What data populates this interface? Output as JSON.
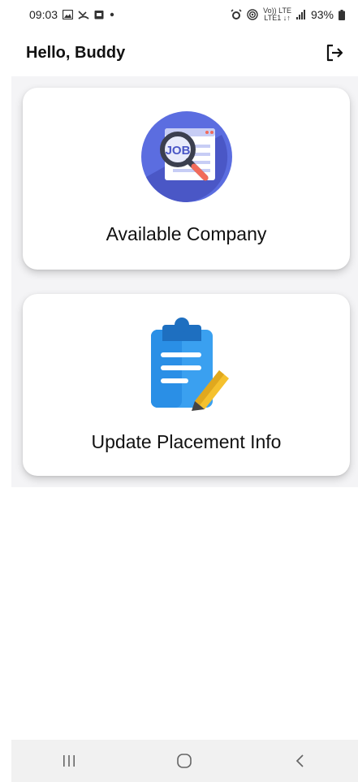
{
  "status_bar": {
    "time": "09:03",
    "battery": "93%",
    "volte_line1": "Vo)) LTE",
    "volte_line2": "LTE1 ↓↑"
  },
  "app_bar": {
    "greeting": "Hello, Buddy"
  },
  "cards": [
    {
      "label": "Available Company",
      "icon": "job-search-icon",
      "icon_text": "JOB"
    },
    {
      "label": "Update Placement Info",
      "icon": "clipboard-edit-icon"
    }
  ],
  "nav_bar": {
    "items": [
      "recent-apps",
      "home",
      "back"
    ]
  },
  "colors": {
    "job_icon_bg": "#5b6de0",
    "clipboard_blue": "#2a8fe6",
    "pencil_yellow": "#f5c12e",
    "nav_bg": "#f1f1f1",
    "content_bg": "#f4f4f6"
  }
}
